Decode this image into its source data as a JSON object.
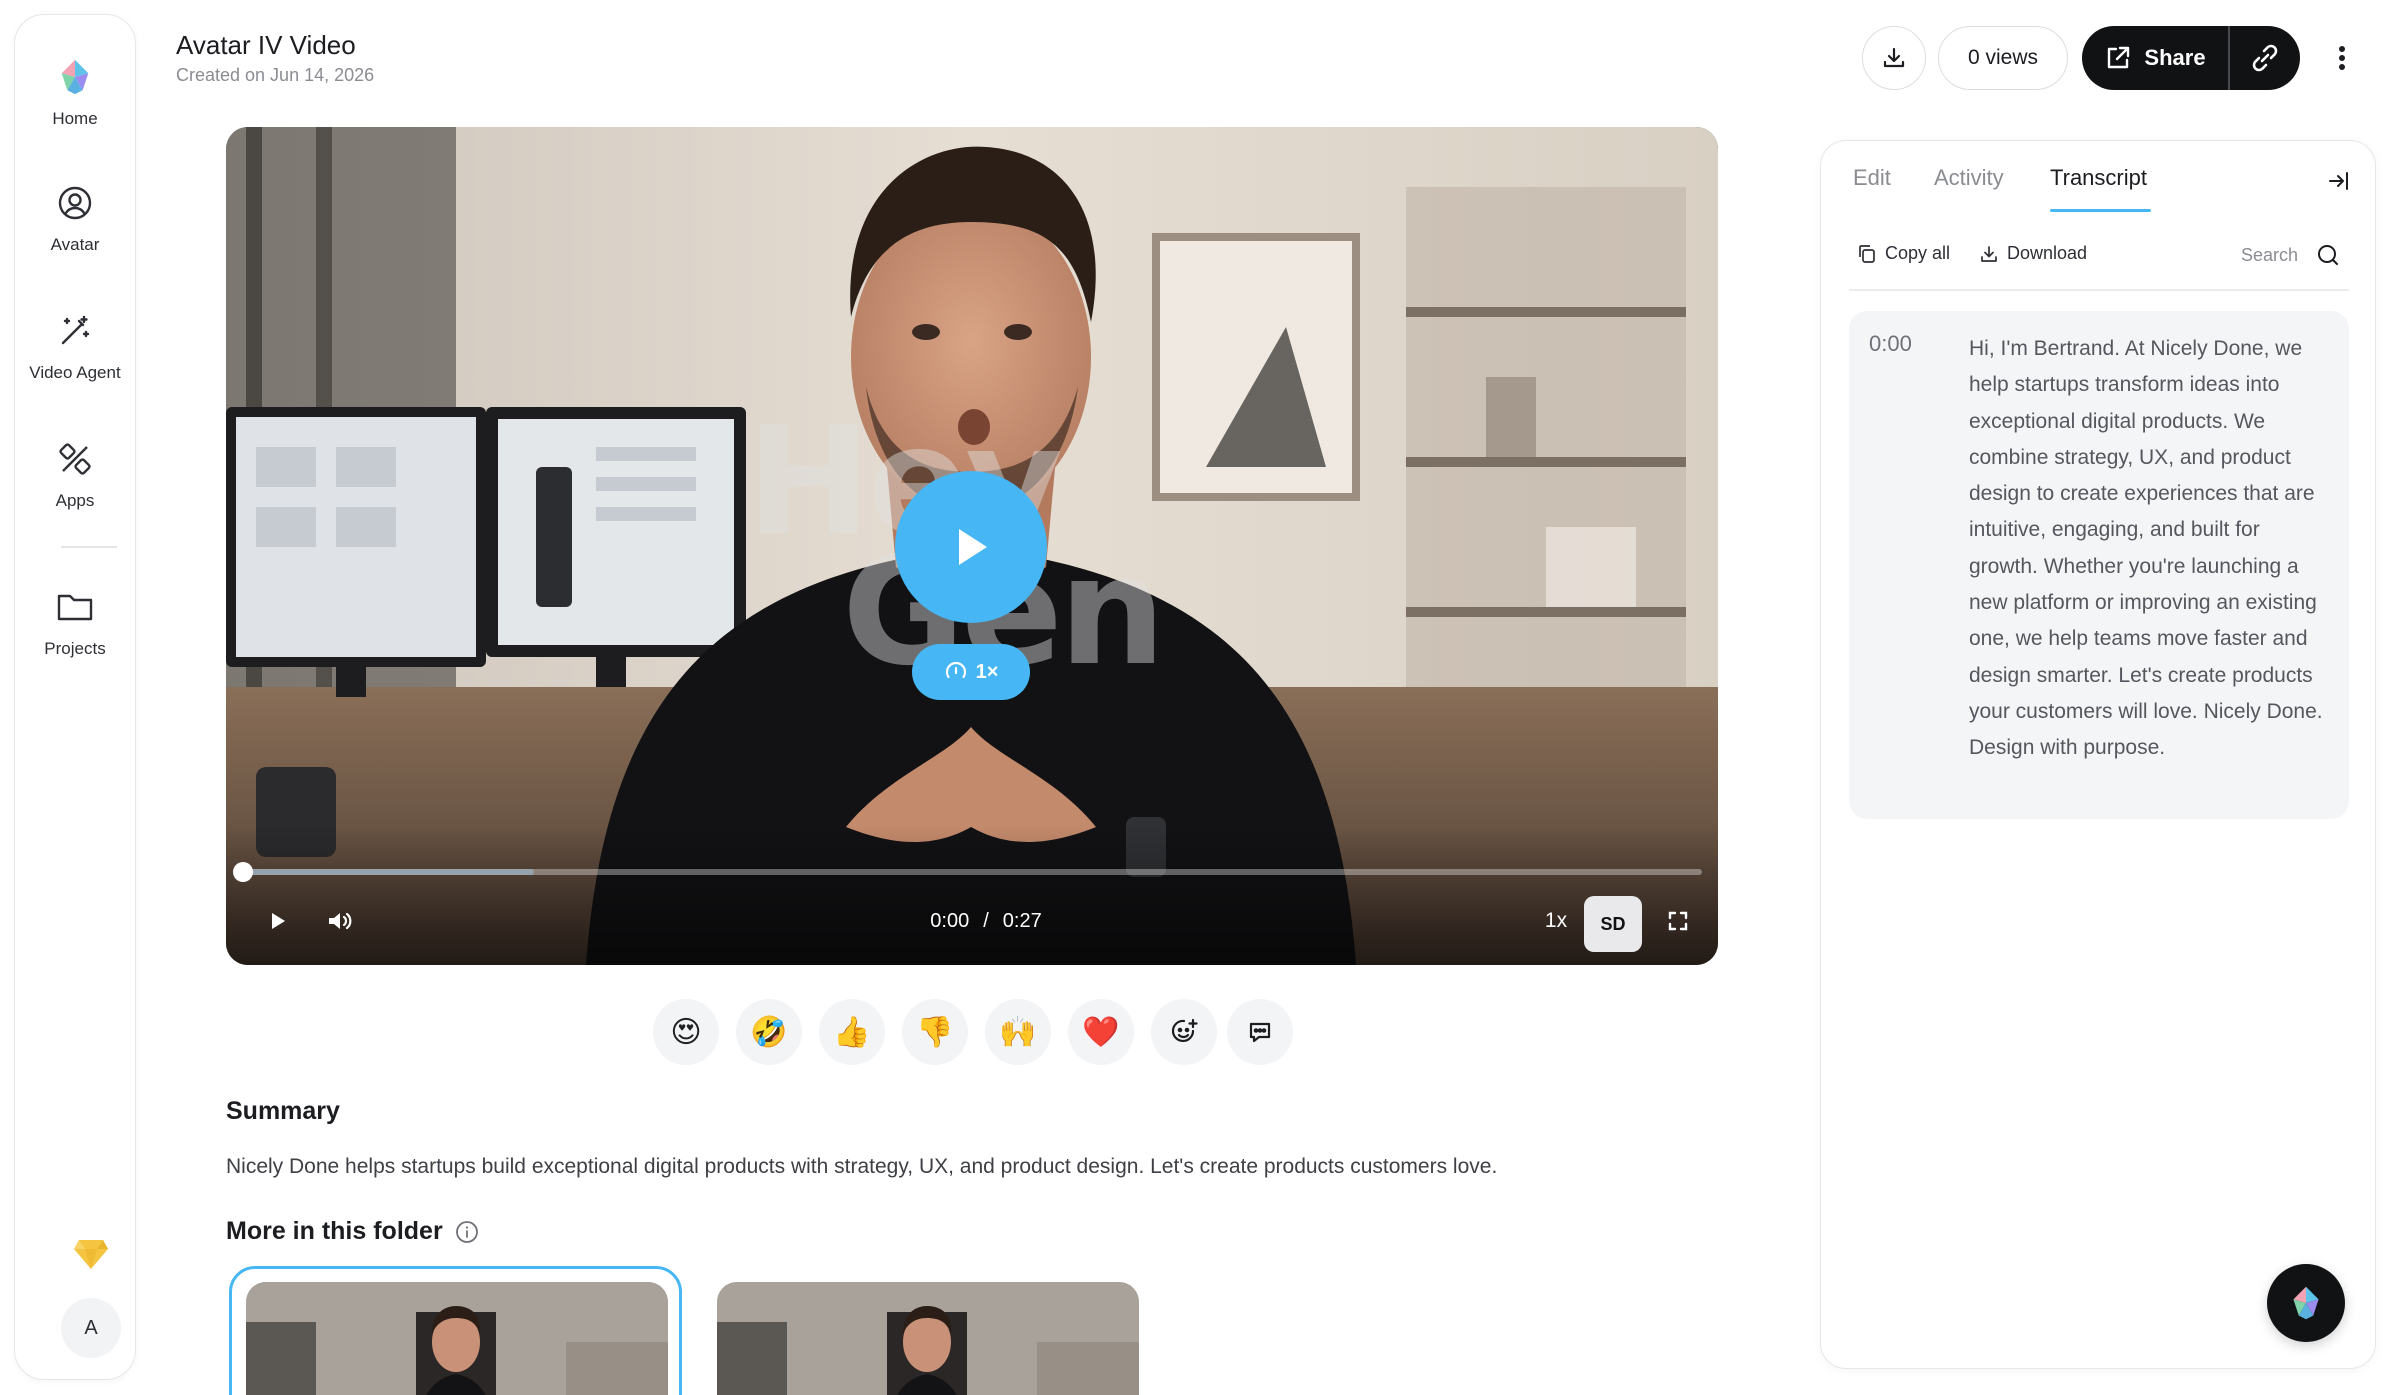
{
  "nav": {
    "items": [
      {
        "label": "Home",
        "icon": "logo-icon"
      },
      {
        "label": "Avatar",
        "icon": "user-circle-icon"
      },
      {
        "label": "Video Agent",
        "icon": "magic-wand-icon"
      },
      {
        "label": "Apps",
        "icon": "tools-icon"
      },
      {
        "label": "Projects",
        "icon": "folder-icon"
      }
    ],
    "avatar_initial": "A"
  },
  "header": {
    "title": "Avatar IV Video",
    "subtitle": "Created on Jun 14, 2026",
    "views": "0 views",
    "share": "Share"
  },
  "player": {
    "watermark_line1": "Hey",
    "watermark_line2": "Gen",
    "speed_badge": "1×",
    "current_time": "0:00",
    "time_separator": "/",
    "duration": "0:27",
    "played_fraction": 0,
    "buffered_fraction": 0.2,
    "rate": "1x",
    "quality": "SD"
  },
  "reactions": [
    "😍",
    "🤣",
    "👍",
    "👎",
    "🙌",
    "❤️"
  ],
  "summary": {
    "heading": "Summary",
    "text": "Nicely Done helps startups build exceptional digital products with strategy, UX, and product design. Let's create products customers love."
  },
  "folder": {
    "heading": "More in this folder"
  },
  "panel": {
    "tabs": [
      {
        "label": "Edit",
        "active": false
      },
      {
        "label": "Activity",
        "active": false
      },
      {
        "label": "Transcript",
        "active": true
      }
    ],
    "copy_all": "Copy all",
    "download": "Download",
    "search": "Search",
    "transcript": [
      {
        "time": "0:00",
        "text": "Hi, I'm Bertrand. At Nicely Done, we help startups transform ideas into exceptional digital products. We combine strategy, UX, and product design to create experiences that are intuitive, engaging, and built for growth. Whether you're launching a new platform or improving an existing one, we help teams move faster and design smarter. Let's create products your customers will love. Nicely Done. Design with purpose."
      }
    ]
  },
  "colors": {
    "accent": "#46b7f4",
    "dark_button": "#111214",
    "tab_underline": "#46b7f4"
  }
}
